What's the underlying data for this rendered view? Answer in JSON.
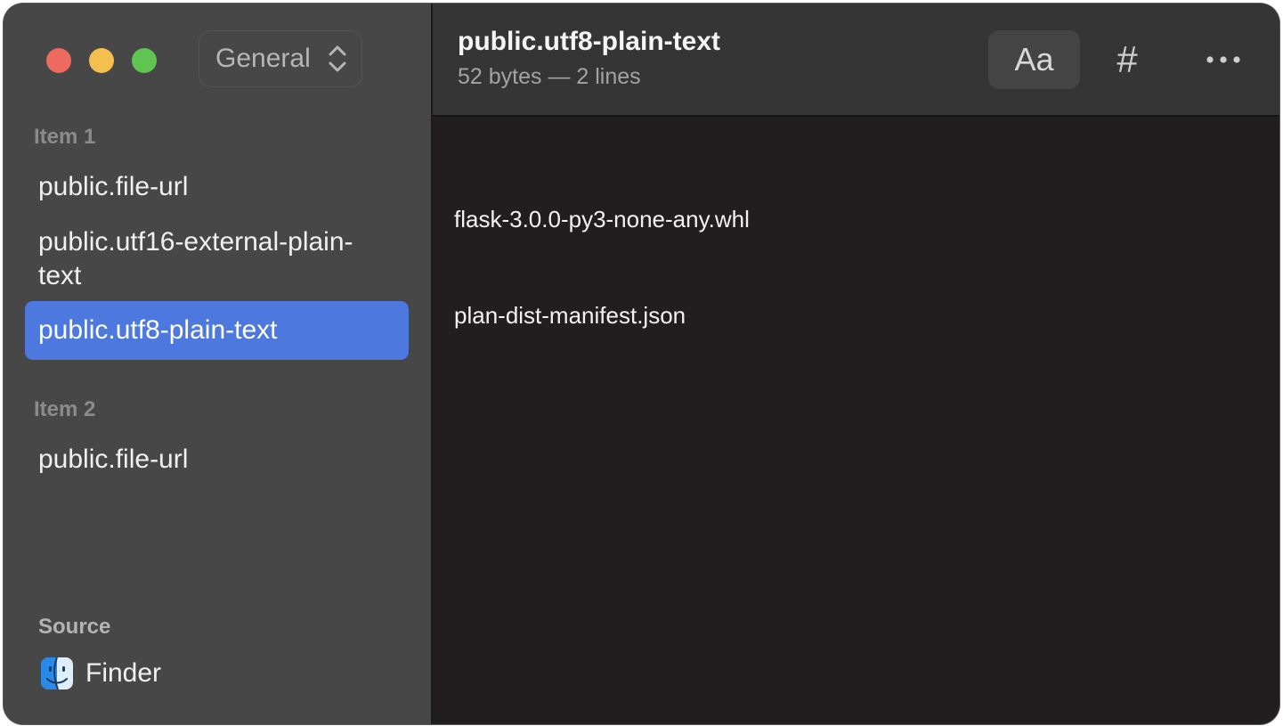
{
  "sidebar": {
    "popup_label": "General",
    "sections": [
      {
        "heading": "Item 1",
        "items": [
          {
            "label": "public.file-url"
          },
          {
            "label": "public.utf16-external-plain-text"
          },
          {
            "label": "public.utf8-plain-text",
            "selected": true
          }
        ]
      },
      {
        "heading": "Item 2",
        "items": [
          {
            "label": "public.file-url"
          }
        ]
      }
    ],
    "source": {
      "heading": "Source",
      "app_label": "Finder",
      "app_icon": "finder-icon"
    }
  },
  "header": {
    "title": "public.utf8-plain-text",
    "subtitle": "52 bytes — 2 lines",
    "font_button_label": "Aa",
    "hash_button_label": "#",
    "more_icon": "ellipsis-icon"
  },
  "content": {
    "lines": [
      "flask-3.0.0-py3-none-any.whl",
      "plan-dist-manifest.json"
    ]
  },
  "colors": {
    "selection": "#4d79de",
    "close": "#ed6a5e",
    "minimize": "#f4bf4f",
    "zoom": "#61c554"
  }
}
